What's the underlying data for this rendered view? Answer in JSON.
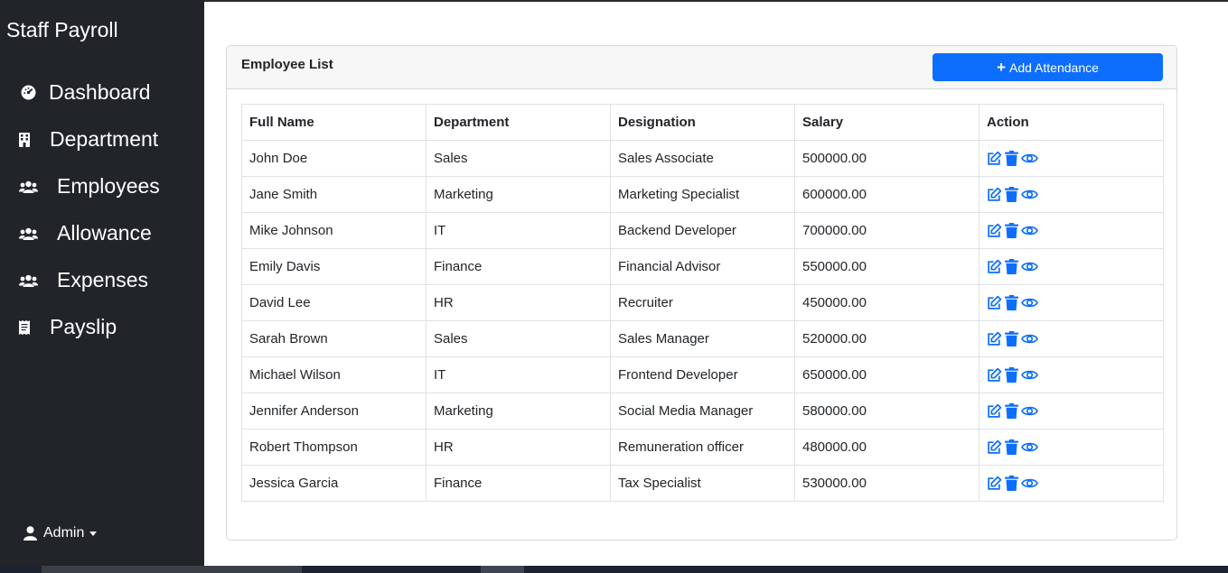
{
  "app": {
    "title": "Staff Payroll",
    "accent_color": "#0d6efd",
    "sidebar_color": "#212529"
  },
  "sidebar": {
    "items": [
      {
        "label": "Dashboard",
        "icon": "tachometer-icon"
      },
      {
        "label": "Department",
        "icon": "building-icon"
      },
      {
        "label": "Employees",
        "icon": "users-icon"
      },
      {
        "label": "Allowance",
        "icon": "users-icon"
      },
      {
        "label": "Expenses",
        "icon": "users-icon"
      },
      {
        "label": "Payslip",
        "icon": "receipt-icon"
      }
    ],
    "user": {
      "label": "Admin",
      "icon": "user-icon"
    }
  },
  "card": {
    "title": "Employee List",
    "add_button": {
      "label": "Add Attendance",
      "icon": "plus-icon"
    }
  },
  "table": {
    "columns": [
      "Full Name",
      "Department",
      "Designation",
      "Salary",
      "Action"
    ],
    "action_icons": [
      "edit-icon",
      "trash-icon",
      "eye-icon"
    ],
    "rows": [
      {
        "name": "John Doe",
        "department": "Sales",
        "designation": "Sales Associate",
        "salary": "500000.00"
      },
      {
        "name": "Jane Smith",
        "department": "Marketing",
        "designation": "Marketing Specialist",
        "salary": "600000.00"
      },
      {
        "name": "Mike Johnson",
        "department": "IT",
        "designation": "Backend Developer",
        "salary": "700000.00"
      },
      {
        "name": "Emily Davis",
        "department": "Finance",
        "designation": "Financial Advisor",
        "salary": "550000.00"
      },
      {
        "name": "David Lee",
        "department": "HR",
        "designation": "Recruiter",
        "salary": "450000.00"
      },
      {
        "name": "Sarah Brown",
        "department": "Sales",
        "designation": "Sales Manager",
        "salary": "520000.00"
      },
      {
        "name": "Michael Wilson",
        "department": "IT",
        "designation": "Frontend Developer",
        "salary": "650000.00"
      },
      {
        "name": "Jennifer Anderson",
        "department": "Marketing",
        "designation": "Social Media Manager",
        "salary": "580000.00"
      },
      {
        "name": "Robert Thompson",
        "department": "HR",
        "designation": "Remuneration officer",
        "salary": "480000.00"
      },
      {
        "name": "Jessica Garcia",
        "department": "Finance",
        "designation": "Tax Specialist",
        "salary": "530000.00"
      }
    ]
  }
}
